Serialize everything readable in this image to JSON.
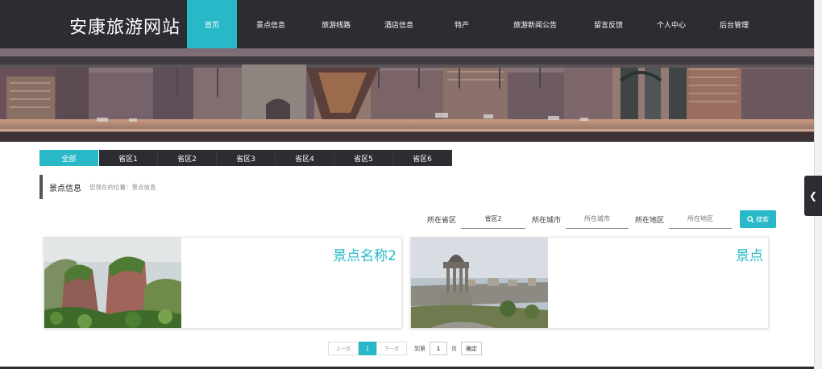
{
  "header": {
    "site_title": "安康旅游网站",
    "nav": [
      "首页",
      "景点信息",
      "旅游线路",
      "酒店信息",
      "特产",
      "旅游新闻公告",
      "留言反馈",
      "个人中心",
      "后台管理"
    ]
  },
  "regions": [
    "全部",
    "省区1",
    "省区2",
    "省区3",
    "省区4",
    "省区5",
    "省区6"
  ],
  "section": {
    "title": "景点信息",
    "breadcrumb": "您现在的位置：景点信息"
  },
  "search": {
    "province_label": "所在省区",
    "province_value": "省区2",
    "city_label": "所在城市",
    "city_placeholder": "所在城市",
    "area_label": "所在地区",
    "area_placeholder": "所在地区",
    "button": "搜索"
  },
  "cards": [
    {
      "title": "景点名称2"
    },
    {
      "title": "景点"
    }
  ],
  "pager": {
    "prev": "上一页",
    "current": "1",
    "next": "下一页",
    "goto_label": "到第",
    "goto_value": "1",
    "unit": "页",
    "confirm": "确定"
  },
  "colors": {
    "accent": "#29b8c7",
    "dark": "#2b2d33"
  }
}
